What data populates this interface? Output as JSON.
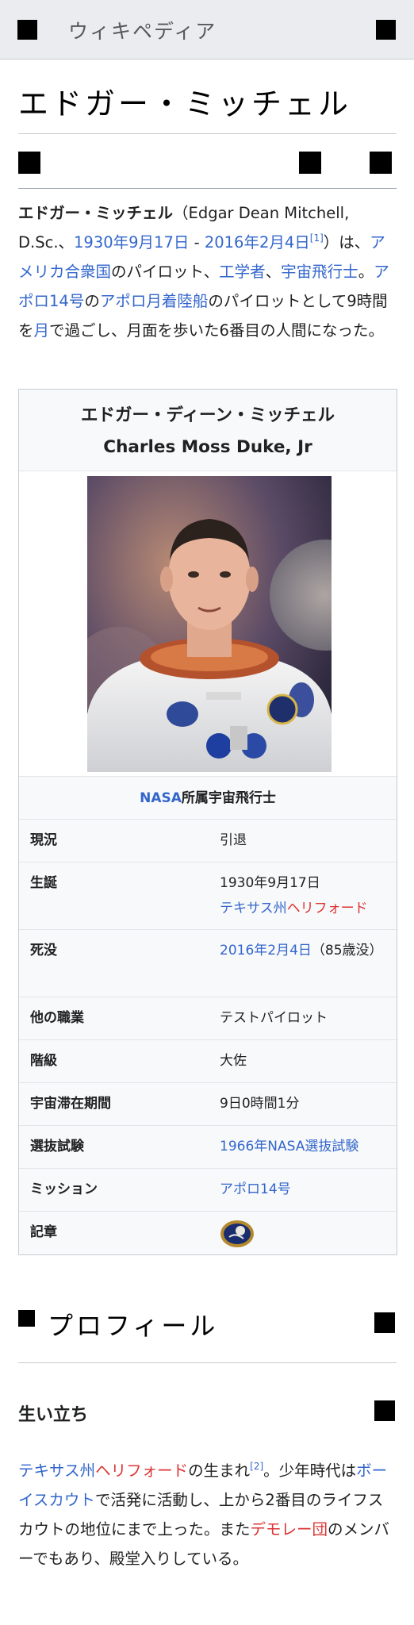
{
  "header": {
    "site_name": "ウィキペディア"
  },
  "article": {
    "title": "エドガー・ミッチェル",
    "lead": {
      "name": "エドガー・ミッチェル",
      "paren_open": "（",
      "name_en": "Edgar Dean Mitchell, D.Sc.、",
      "birth_date": "1930年9月17日",
      "dash": " - ",
      "death_date": "2016年2月4日",
      "ref1": "[1]",
      "t1": "）は、",
      "link_usa": "アメリカ合衆国",
      "t2": "のパイロット、",
      "link_engineer": "工学者",
      "t3": "、",
      "link_astronaut": "宇宙飛行士",
      "t4": "。",
      "link_apollo14": "アポロ14号",
      "t5": "の",
      "link_lm": "アポロ月着陸船",
      "t6": "のパイロットとして9時間を",
      "link_moon": "月",
      "t7": "で過ごし、月面を歩いた6番目の人間になった。"
    }
  },
  "infobox": {
    "title_ja": "エドガー・ディーン・ミッチェル",
    "title_en": "Charles Moss Duke, Jr",
    "caption_link": "NASA",
    "caption_text": "所属宇宙飛行士",
    "rows": {
      "status": {
        "label": "現況",
        "value": "引退"
      },
      "birth": {
        "label": "生誕",
        "date": "1930年9月17日",
        "place_link1": "テキサス州",
        "place_link2": "ヘリフォード"
      },
      "death": {
        "label": "死没",
        "date": "2016年2月4日",
        "age": "（85歳没）"
      },
      "occupation": {
        "label": "他の職業",
        "value": "テストパイロット"
      },
      "rank": {
        "label": "階級",
        "value": "大佐"
      },
      "time_in_space": {
        "label": "宇宙滞在期間",
        "value": "9日0時間1分"
      },
      "selection": {
        "label": "選抜試験",
        "value": "1966年NASA選抜試験"
      },
      "mission": {
        "label": "ミッション",
        "value": "アポロ14号"
      },
      "insignia": {
        "label": "記章"
      }
    }
  },
  "sections": {
    "profile": {
      "heading": "プロフィール"
    },
    "early_life": {
      "heading": "生い立ち",
      "link1": "テキサス州",
      "link2": "ヘリフォード",
      "t1": "の生まれ",
      "ref2": "[2]",
      "t2": "。少年時代は",
      "link3": "ボーイスカウト",
      "t3": "で活発に活動し、上から2番目のライフスカウトの地位にまで上った。また",
      "link4": "デモレー団",
      "t4": "のメンバーでもあり、殿堂入りしている。"
    }
  },
  "colors": {
    "link": "#3366cc",
    "redlink": "#d33333",
    "chrome": "#eaecf0"
  }
}
